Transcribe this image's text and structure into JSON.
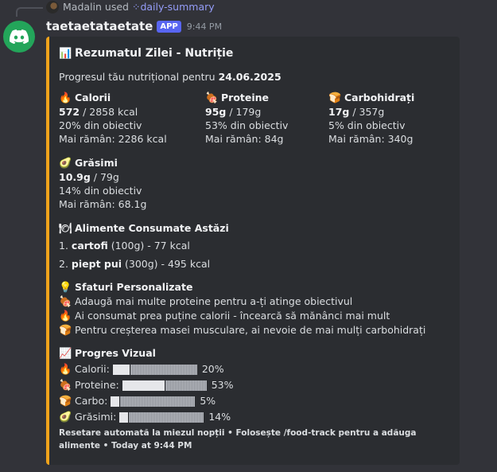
{
  "reply": {
    "user": "Madalin",
    "used": "used",
    "command_icon": "slash-command-icon",
    "command": "daily-summary"
  },
  "header": {
    "username": "taetaetataetate",
    "badge": "APP",
    "timestamp": "9:44 PM"
  },
  "accent_color": "#f0a31b",
  "embed": {
    "title_icon": "📊",
    "title": "Rezumatul Zilei - Nutriție",
    "description_prefix": "Progresul tău nutrițional pentru ",
    "description_date": "24.06.2025",
    "fields": [
      {
        "icon": "🔥",
        "name": "Calorii",
        "current": "572",
        "total": " / 2858 kcal",
        "percent": "20% din obiectiv",
        "remaining": "Mai rămân: 2286 kcal"
      },
      {
        "icon": "🍖",
        "name": "Proteine",
        "current": "95g",
        "total": " / 179g",
        "percent": "53% din obiectiv",
        "remaining": "Mai rămân: 84g"
      },
      {
        "icon": "🍞",
        "name": "Carbohidrați",
        "current": "17g",
        "total": " / 357g",
        "percent": "5% din obiectiv",
        "remaining": "Mai rămân: 340g"
      },
      {
        "icon": "🥑",
        "name": "Grăsimi",
        "current": "10.9g",
        "total": " / 79g",
        "percent": "14% din obiectiv",
        "remaining": "Mai rămân: 68.1g"
      }
    ],
    "foods": {
      "icon": "🍽",
      "name": "Alimente Consumate Astăzi",
      "items": [
        {
          "num": "1. ",
          "food": "cartofi",
          "qty": " (100g) - 77 kcal"
        },
        {
          "num": "2. ",
          "food": "piept pui",
          "qty": " (300g) - 495 kcal"
        }
      ]
    },
    "tips": {
      "icon": "💡",
      "name": "Sfaturi Personalizate",
      "items": [
        {
          "icon": "🍖",
          "text": "Adaugă mai multe proteine pentru a-ți atinge obiectivul"
        },
        {
          "icon": "🔥",
          "text": "Ai consumat prea puține calorii - încearcă să mănânci mai mult"
        },
        {
          "icon": "🍞",
          "text": "Pentru creșterea masei musculare, ai nevoie de mai mulți carbohidrați"
        }
      ]
    },
    "progress": {
      "icon": "📈",
      "name": "Progres Vizual",
      "rows": [
        {
          "icon": "🔥",
          "label": "Calorii:",
          "fraction": 0.2,
          "value": "20%"
        },
        {
          "icon": "🍖",
          "label": "Proteine:",
          "fraction": 0.53,
          "value": "53%"
        },
        {
          "icon": "🍞",
          "label": "Carbo:",
          "fraction": 0.05,
          "value": "5%"
        },
        {
          "icon": "🥑",
          "label": "Grăsimi:",
          "fraction": 0.14,
          "value": "14%"
        }
      ]
    },
    "footer": "Resetare automată la miezul nopții • Folosește /food-track pentru a adăuga alimente • Today at 9:44 PM"
  }
}
